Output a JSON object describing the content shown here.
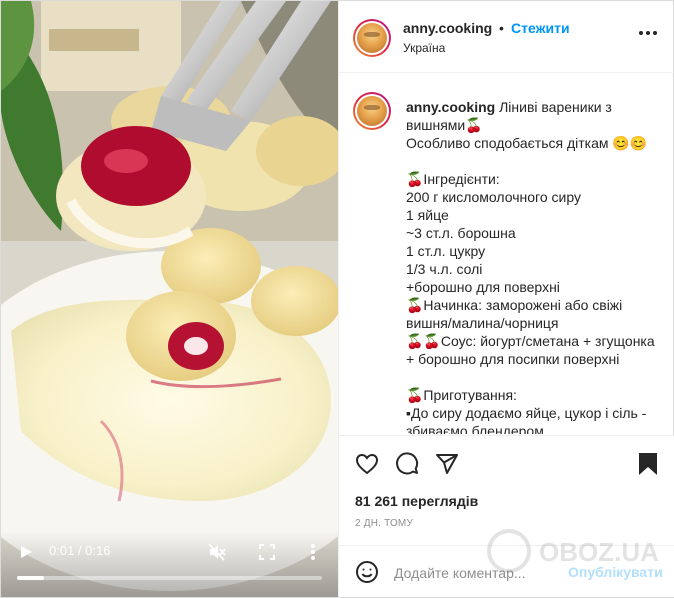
{
  "post": {
    "username": "anny.cooking",
    "follow_label": "Стежити",
    "separator": "•",
    "location": "Україна"
  },
  "caption": {
    "username": "anny.cooking",
    "lines": [
      "Ліниві вареники з",
      "вишнями🍒",
      "Особливо сподобається діткам 😊😊",
      "",
      "🍒Інгредієнти:",
      "200 г кисломолочного сиру",
      "1 яйце",
      "~3 ст.л. борошна",
      "1 ст.л. цукру",
      "1/3 ч.л. солі",
      "+борошно для поверхні",
      "🍒Начинка: заморожені або свіжі",
      "вишня/малина/чорниця",
      "🍒🍒Соус: йогурт/сметана + згущонка",
      "+ борошно для посипки поверхні",
      "",
      "🍒Приготування:",
      "▪До сиру додаємо яйце, цукор і сіль -",
      "збиваємо блендером"
    ]
  },
  "video": {
    "time": "0:01 / 0:16",
    "progress_fraction": 0.09
  },
  "actions": {
    "views": "81 261 переглядів",
    "time_ago": "2 дн. тому"
  },
  "comment": {
    "placeholder": "Додайте коментар...",
    "publish_label": "Опублікувати"
  },
  "icons": {
    "like": "heart-icon",
    "comment": "comment-icon",
    "share": "paper-plane-icon",
    "save": "bookmark-icon",
    "emoji": "emoji-icon",
    "play": "play-icon",
    "mute": "muted-speaker-icon",
    "fullscreen": "fullscreen-icon",
    "more": "more-vertical-icon"
  },
  "colors": {
    "link_blue": "#0095f6",
    "publish_disabled": "#b2dffc",
    "text": "#262626",
    "muted": "#8e8e8e",
    "divider": "#efefef"
  },
  "watermark": "OBOZ.UA"
}
